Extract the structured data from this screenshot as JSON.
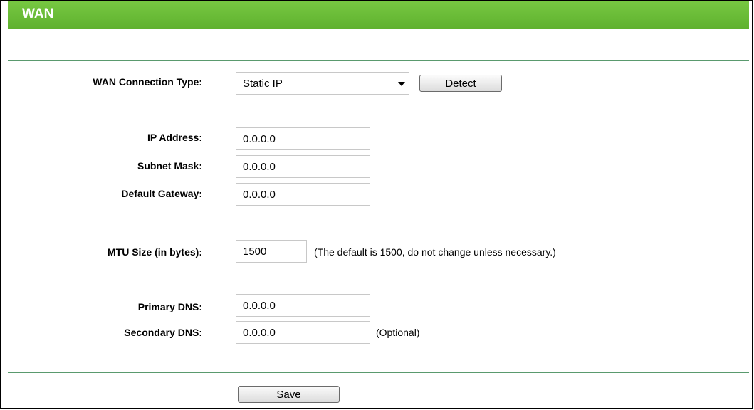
{
  "header": {
    "title": "WAN"
  },
  "connection": {
    "label": "WAN Connection Type:",
    "selected": "Static IP",
    "detect_label": "Detect"
  },
  "fields": {
    "ip_address": {
      "label": "IP Address:",
      "value": "0.0.0.0"
    },
    "subnet_mask": {
      "label": "Subnet Mask:",
      "value": "0.0.0.0"
    },
    "default_gateway": {
      "label": "Default Gateway:",
      "value": "0.0.0.0"
    },
    "mtu": {
      "label": "MTU Size (in bytes):",
      "value": "1500",
      "note": "(The default is 1500, do not change unless necessary.)"
    },
    "primary_dns": {
      "label": "Primary DNS:",
      "value": "0.0.0.0"
    },
    "secondary_dns": {
      "label": "Secondary DNS:",
      "value": "0.0.0.0",
      "note": "(Optional)"
    }
  },
  "footer": {
    "save_label": "Save"
  },
  "colors": {
    "header_green": "#66bb33",
    "divider": "#5a9a6e"
  }
}
